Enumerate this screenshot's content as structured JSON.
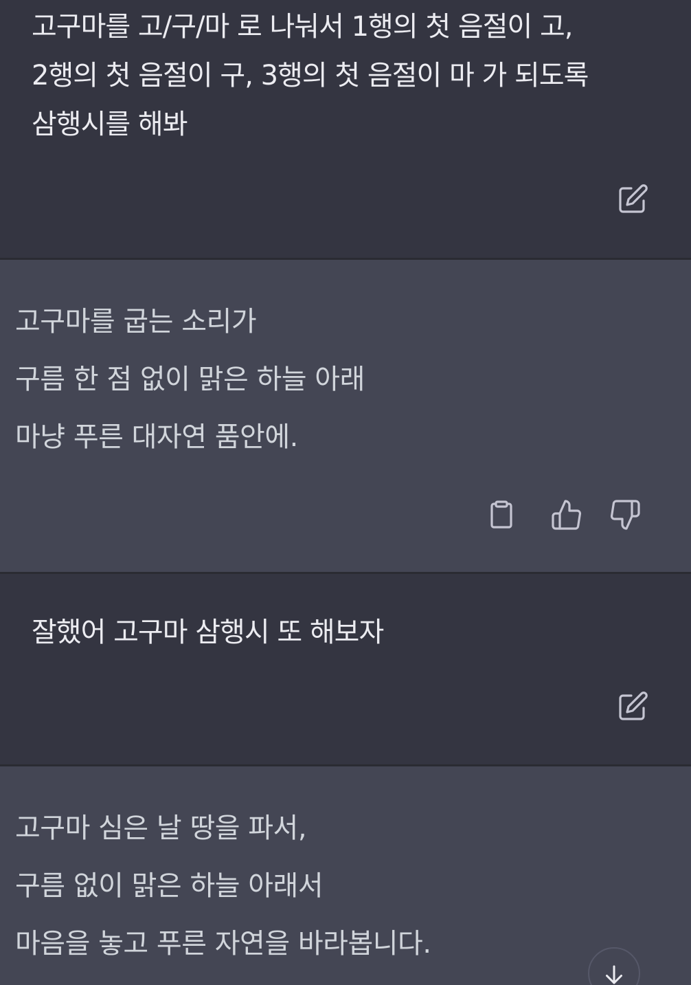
{
  "messages": [
    {
      "role": "user",
      "text": "고구마를 고/구/마 로 나눠서 1행의 첫 음절이 고,\n2행의 첫 음절이 구, 3행의 첫 음절이 마 가 되도록\n삼행시를 해봐",
      "actions": [
        "edit-icon"
      ]
    },
    {
      "role": "assistant",
      "text": "고구마를 굽는 소리가\n구름 한 점 없이 맑은 하늘 아래\n마냥 푸른 대자연 품안에.",
      "actions": [
        "copy-icon",
        "thumbs-up-icon",
        "thumbs-down-icon"
      ]
    },
    {
      "role": "user",
      "text": "잘했어 고구마 삼행시 또 해보자",
      "actions": [
        "edit-icon"
      ]
    },
    {
      "role": "assistant",
      "text": "고구마 심은 날 땅을 파서,\n구름 없이 맑은 하늘 아래서\n마음을 놓고 푸른 자연을 바라봅니다.",
      "actions": []
    }
  ],
  "scroll_button_icon": "arrow-down-icon",
  "colors": {
    "user_bg": "#343541",
    "assistant_bg": "#444654",
    "divider": "#2a2b32",
    "user_text": "#ececf1",
    "assistant_text": "#d1d5db",
    "icon": "#c5c5d2"
  }
}
